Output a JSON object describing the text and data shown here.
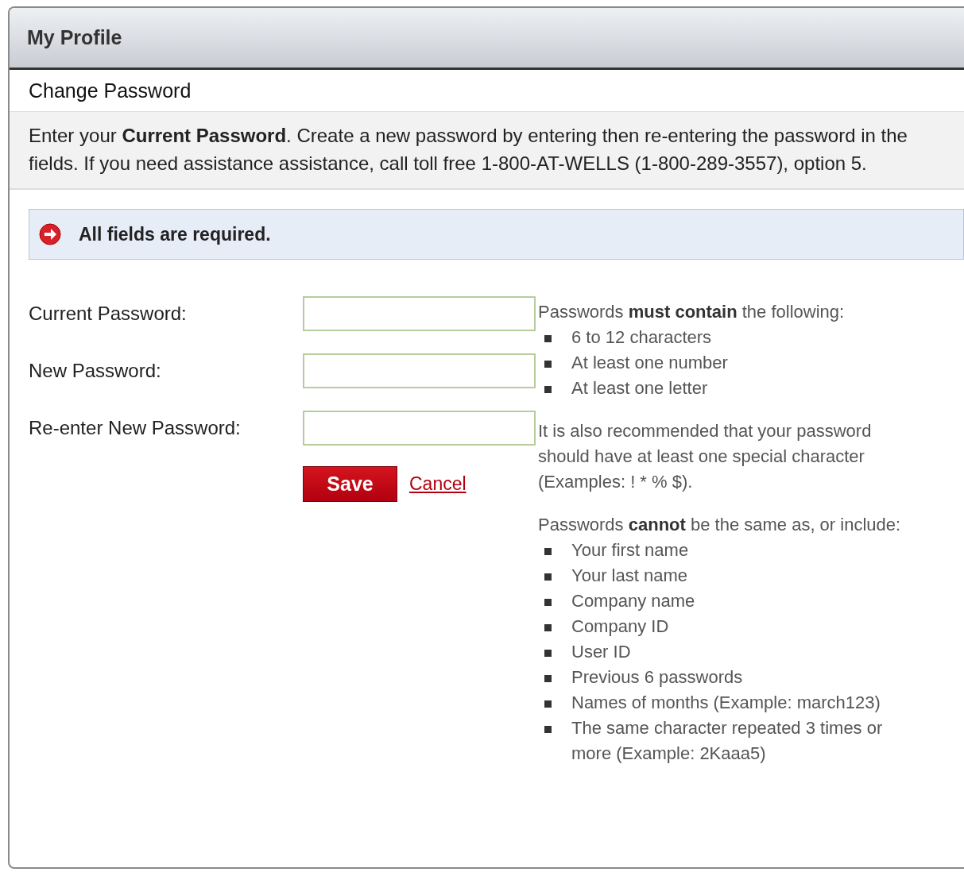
{
  "panel": {
    "title": "My Profile"
  },
  "section": {
    "title": "Change Password",
    "description": "Enter your **Current Password**. Create a new password by entering then re-entering the password in the fields. If you need assistance assistance, call toll free 1-800-AT-WELLS (1-800-289-3557), option 5."
  },
  "alert": {
    "text": "All fields are required."
  },
  "form": {
    "fields": [
      {
        "label": "Current Password:"
      },
      {
        "label": "New Password:"
      },
      {
        "label": "Re-enter New Password:"
      }
    ],
    "save": "Save",
    "cancel": "Cancel"
  },
  "rules": {
    "intro": "Passwords **must contain** the following:",
    "must": [
      "6 to 12 characters",
      "At least one number",
      "At least one letter"
    ],
    "recommendation": "It is also recommended that your password should have at least one special character (Examples: ! * % $).",
    "cannot_intro": "Passwords **cannot** be the same as, or include:",
    "cannot": [
      "Your first name",
      "Your last name",
      "Company name",
      "Company ID",
      "User ID",
      "Previous 6 passwords",
      "Names of months (Example: march123)",
      "The same character repeated 3 times or more (Example: 2Kaaa5)"
    ]
  }
}
